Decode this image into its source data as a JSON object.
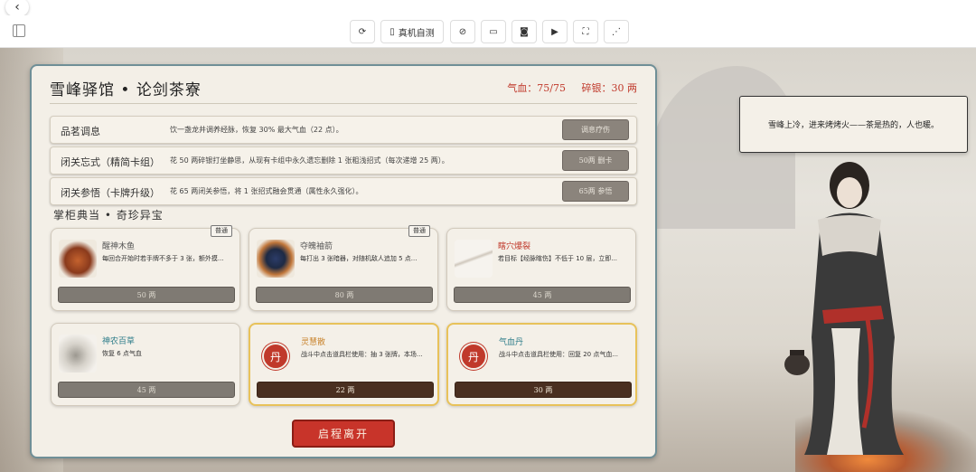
{
  "toolbar": {
    "buttons": [
      "refresh",
      "真机自测",
      "hide",
      "devices",
      "screenshot",
      "record",
      "fullscreen",
      "share"
    ],
    "real_device_label": "真机自测"
  },
  "panel": {
    "title": "雪峰驿馆  •  论剑茶寮",
    "hp_label": "气血：75/75",
    "silver_label": "碎银：30 两"
  },
  "services": [
    {
      "name": "品茗调息",
      "desc": "饮一盏龙井调养经脉，恢复 30% 最大气血（22 点）。",
      "button": "调息疗伤"
    },
    {
      "name": "闭关忘式（精简卡组）",
      "desc": "花 50 两碎银打坐静思，从现有卡组中永久遗忘删除 1 张粗浅招式（每次递增 25 两）。",
      "button": "50两 删卡"
    },
    {
      "name": "闭关参悟（卡牌升级）",
      "desc": "花 65 两闭关参悟，将 1 张招式融会贯通（属性永久强化）。",
      "button": "65两 参悟"
    }
  ],
  "shop": {
    "title": "掌柜典当  •  奇珍异宝",
    "items": [
      {
        "name": "醒神木鱼",
        "desc": "每回合开始时若手牌不多于 3 张，额外摸...",
        "price": "50 两",
        "tag": "普通",
        "name_color": "#555555"
      },
      {
        "name": "夺魄袖箭",
        "desc": "每打出 3 张暗器，对随机敌人追加 5 点...",
        "price": "80 两",
        "tag": "普通",
        "name_color": "#555555"
      },
      {
        "name": "瞎穴爆裂",
        "desc": "若目标【经脉瞎伤】不低于 10 层，立即...",
        "price": "45 两",
        "tag": "",
        "name_color": "#c0392b"
      },
      {
        "name": "神农百草",
        "desc": "恢复 6 点气血",
        "price": "45 两",
        "tag": "",
        "name_color": "#2e7d8a"
      },
      {
        "name": "灵慧散",
        "desc": "战斗中点击道具栏使用：抽 3 张牌，本场...",
        "price": "22 两",
        "tag": "",
        "name_color": "#c8822a",
        "icon": "丹"
      },
      {
        "name": "气血丹",
        "desc": "战斗中点击道具栏使用：回复 20 点气血...",
        "price": "30 两",
        "tag": "",
        "name_color": "#2e7d8a",
        "icon": "丹"
      }
    ]
  },
  "leave_button": "启程离开",
  "npc_dialog": "雪峰上冷，进来烤烤火——茶是热的，人也暖。",
  "colors": {
    "panel_border": "#6f8f97",
    "accent_red": "#c8342a",
    "gold": "#e8c25a"
  }
}
